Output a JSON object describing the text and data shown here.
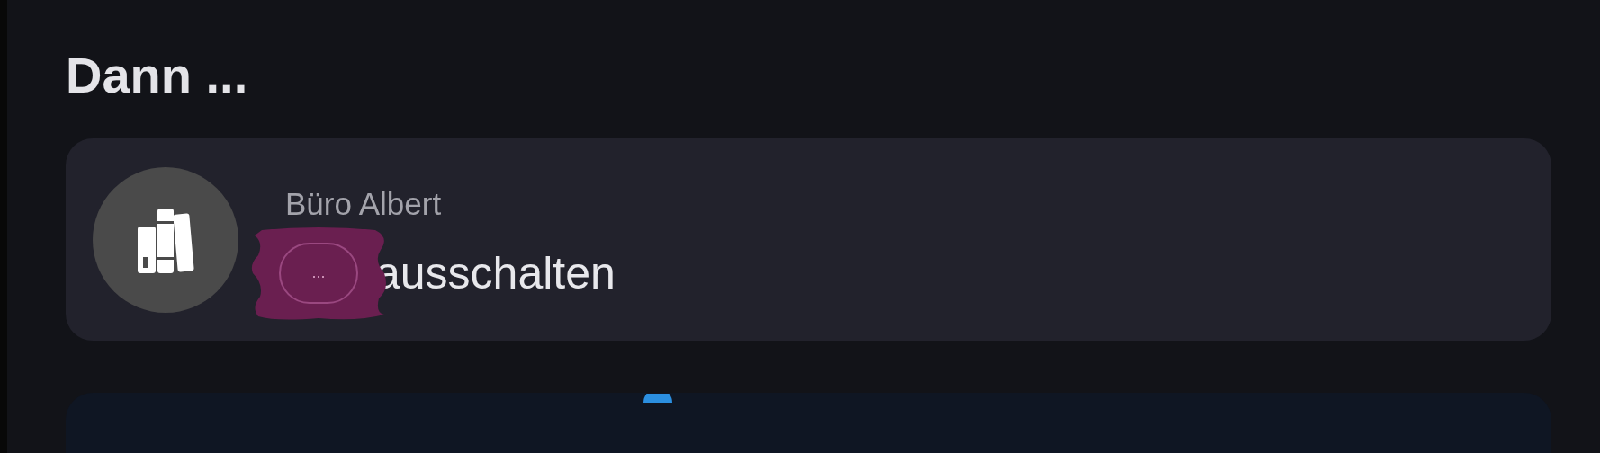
{
  "section_title": "Dann ...",
  "actions": [
    {
      "kind": "device",
      "device": "Büro Albert",
      "chip": "...",
      "action": "ausschalten",
      "redacted": true
    }
  ]
}
